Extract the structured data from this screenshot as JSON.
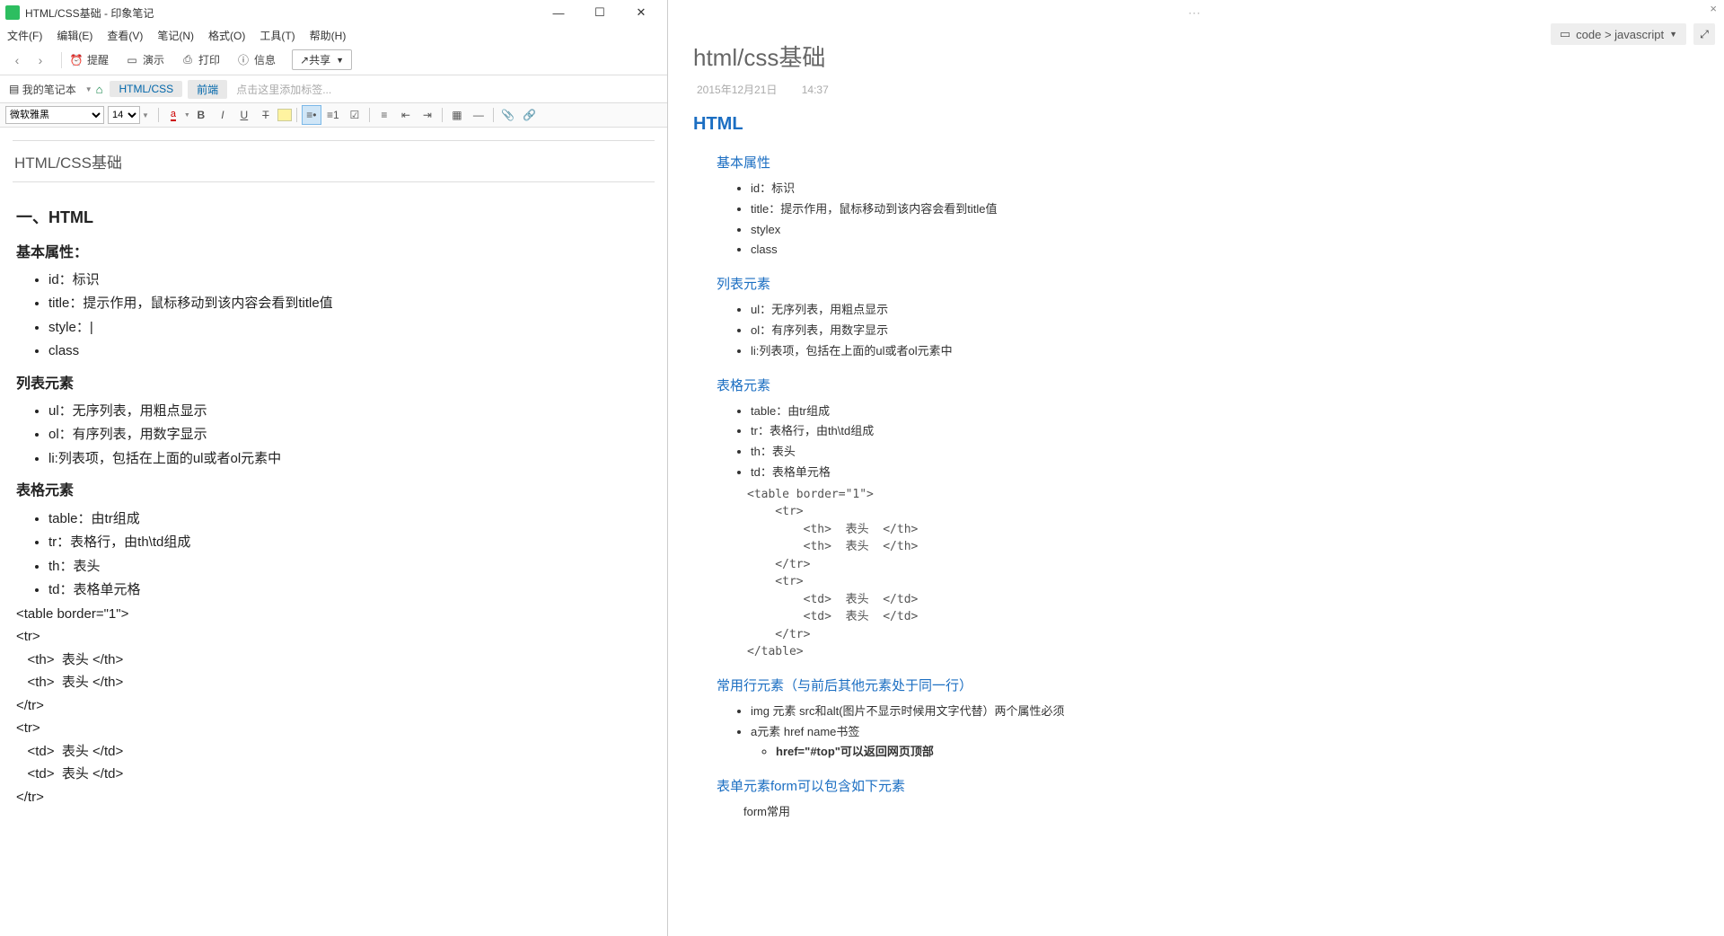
{
  "window": {
    "title": "HTML/CSS基础 - 印象笔记"
  },
  "menubar": {
    "file": "文件(F)",
    "edit": "编辑(E)",
    "view": "查看(V)",
    "note": "笔记(N)",
    "format": "格式(O)",
    "tools": "工具(T)",
    "help": "帮助(H)"
  },
  "toolbar": {
    "reminder": "提醒",
    "present": "演示",
    "print": "打印",
    "info": "信息",
    "share": "共享"
  },
  "tagbar": {
    "notebook": "我的笔记本",
    "tag1": "HTML/CSS",
    "tag2": "前端",
    "placeholder": "点击这里添加标签..."
  },
  "fmt": {
    "font": "微软雅黑",
    "size": "14"
  },
  "note": {
    "title": "HTML/CSS基础",
    "h1": "一、HTML",
    "s1": {
      "h": "基本属性：",
      "i1": "id：标识",
      "i2": "title：提示作用，鼠标移动到该内容会看到title值",
      "i3": "style：|",
      "i4": "class"
    },
    "s2": {
      "h": "列表元素",
      "i1": "ul：无序列表，用粗点显示",
      "i2": "ol：有序列表，用数字显示",
      "i3": "li:列表项，包括在上面的ul或者ol元素中"
    },
    "s3": {
      "h": "表格元素",
      "i1": "table：由tr组成",
      "i2": "tr：表格行，由th\\td组成",
      "i3": "th：表头",
      "i4": "td：表格单元格"
    },
    "code": "<table border=\"1\">\n<tr>\n   <th>  表头 </th>\n   <th>  表头 </th>\n</tr>\n<tr>\n   <td>  表头 </td>\n   <td>  表头 </td>\n</tr>"
  },
  "right": {
    "breadcrumb": "code > javascript",
    "title": "html/css基础",
    "date": "2015年12月21日",
    "time": "14:37",
    "h_html": "HTML",
    "s1": {
      "h": "基本属性",
      "i1": "id：标识",
      "i2": "title：提示作用，鼠标移动到该内容会看到title值",
      "i3": "stylex",
      "i4": "class"
    },
    "s2": {
      "h": "列表元素",
      "i1": "ul：无序列表，用粗点显示",
      "i2": "ol：有序列表，用数字显示",
      "i3": "li:列表项，包括在上面的ul或者ol元素中"
    },
    "s3": {
      "h": "表格元素",
      "i1": "table：由tr组成",
      "i2": "tr：表格行，由th\\td组成",
      "i3": "th：表头",
      "i4": "td：表格单元格"
    },
    "code": "<table border=\"1\">\n    <tr>\n        <th>  表头  </th>\n        <th>  表头  </th>\n    </tr>\n    <tr>\n        <td>  表头  </td>\n        <td>  表头  </td>\n    </tr>\n</table>",
    "s4": {
      "h": "常用行元素（与前后其他元素处于同一行）",
      "i1": "img 元素 src和alt(图片不显示时候用文字代替）两个属性必须",
      "i2": "a元素 href name书签",
      "i2a": "href=\"#top\"可以返回网页顶部"
    },
    "s5": {
      "h": "表单元素form可以包含如下元素",
      "t1": "form常用"
    }
  }
}
